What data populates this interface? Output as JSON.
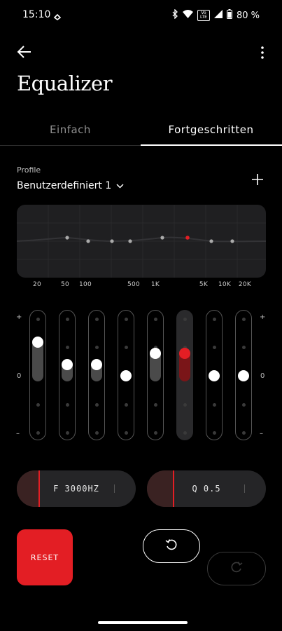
{
  "status_bar": {
    "time": "15:10",
    "volte": "Vo LTE",
    "battery": "80 %",
    "icons": [
      "nfc-icon",
      "bluetooth-icon",
      "wifi-icon",
      "volte-icon",
      "signal-icon",
      "battery-icon"
    ]
  },
  "header": {
    "back_icon": "back-arrow-icon",
    "menu_icon": "more-vert-icon",
    "title": "Equalizer"
  },
  "tabs": [
    {
      "label": "Einfach",
      "selected": false
    },
    {
      "label": "Fortgeschritten",
      "selected": true
    }
  ],
  "profile": {
    "label": "Profile",
    "value": "Benutzerdefiniert 1",
    "add_icon": "plus-icon"
  },
  "graph": {
    "frequency_labels": [
      "20",
      "50",
      "100",
      "500",
      "1K",
      "5K",
      "10K",
      "20K"
    ],
    "selected_band_index": 5
  },
  "sliders": {
    "plus_label": "+",
    "zero_label": "0",
    "minus_label": "–",
    "bands": [
      {
        "level": 0.6
      },
      {
        "level": 0.2
      },
      {
        "level": 0.2
      },
      {
        "level": 0.0
      },
      {
        "level": 0.4
      },
      {
        "level": 0.4,
        "active": true
      },
      {
        "level": 0.0
      },
      {
        "level": 0.0
      }
    ]
  },
  "controls": {
    "frequency": {
      "label": "F 3000HZ",
      "position": 0.18
    },
    "q_factor": {
      "label": "Q 0.5",
      "position": 0.22
    }
  },
  "buttons": {
    "reset": "RESET",
    "undo_icon": "undo-icon",
    "redo_icon": "redo-icon"
  },
  "colors": {
    "accent": "#e31e24",
    "background": "#000000",
    "panel": "#1f1f21"
  }
}
